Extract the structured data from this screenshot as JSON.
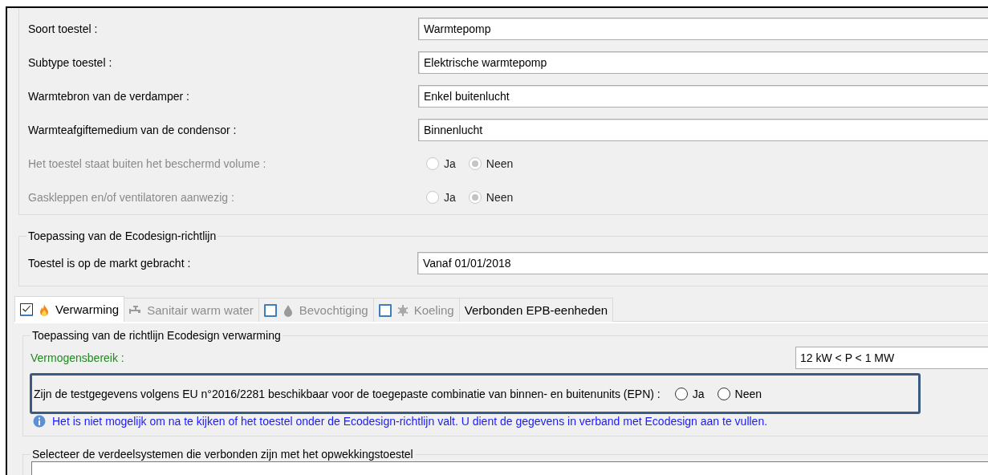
{
  "device": {
    "rows": [
      {
        "kind": "field",
        "label": "Soort toestel :",
        "value": "Warmtepomp",
        "disabled": false
      },
      {
        "kind": "field",
        "label": "Subtype toestel :",
        "value": "Elektrische warmtepomp",
        "disabled": false
      },
      {
        "kind": "field",
        "label": "Warmtebron van de verdamper :",
        "value": "Enkel buitenlucht",
        "disabled": false
      },
      {
        "kind": "field",
        "label": "Warmteafgiftemedium van de condensor :",
        "value": "Binnenlucht",
        "disabled": false
      },
      {
        "kind": "radio",
        "label": "Het toestel staat buiten het beschermd volume :",
        "disabled": true,
        "options": [
          {
            "label": "Ja",
            "selected": false
          },
          {
            "label": "Neen",
            "selected": true
          }
        ]
      },
      {
        "kind": "radio",
        "label": "Gaskleppen en/of ventilatoren aanwezig :",
        "disabled": true,
        "options": [
          {
            "label": "Ja",
            "selected": false
          },
          {
            "label": "Neen",
            "selected": true
          }
        ]
      }
    ]
  },
  "ecodesign": {
    "title": "Toepassing van de Ecodesign-richtlijn",
    "rows": [
      {
        "kind": "field",
        "label": "Toestel is op de markt gebracht :",
        "value": "Vanaf 01/01/2018",
        "disabled": false
      }
    ]
  },
  "tabs": [
    {
      "label": "Verwarming",
      "selected": true,
      "disabled": false,
      "checked": true
    },
    {
      "label": "Sanitair warm water",
      "selected": false,
      "disabled": true
    },
    {
      "label": "Bevochtiging",
      "selected": false,
      "disabled": true,
      "checked": false
    },
    {
      "label": "Koeling",
      "selected": false,
      "disabled": true,
      "checked": false
    },
    {
      "label": "Verbonden EPB-eenheden",
      "selected": false,
      "disabled": false
    }
  ],
  "heating": {
    "title": "Toepassing van de richtlijn Ecodesign verwarming",
    "power_range": {
      "label": "Vermogensbereik :",
      "value": "12 kW < P < 1 MW"
    },
    "question": {
      "label": "Zijn de testgegevens volgens EU n°2016/2281 beschikbaar voor de toegepaste combinatie van binnen- en buitenunits (EPN) :",
      "highlighted": true,
      "options": [
        {
          "label": "Ja",
          "selected": false
        },
        {
          "label": "Neen",
          "selected": false
        }
      ]
    },
    "info": "Het is niet mogelijk om na te kijken of het toestel onder de Ecodesign-richtlijn valt. U dient de gegevens in verband met Ecodesign aan te vullen."
  },
  "distribution": {
    "title": "Selecteer de verdeelsystemen die verbonden zijn met het opwekkingstoestel"
  }
}
